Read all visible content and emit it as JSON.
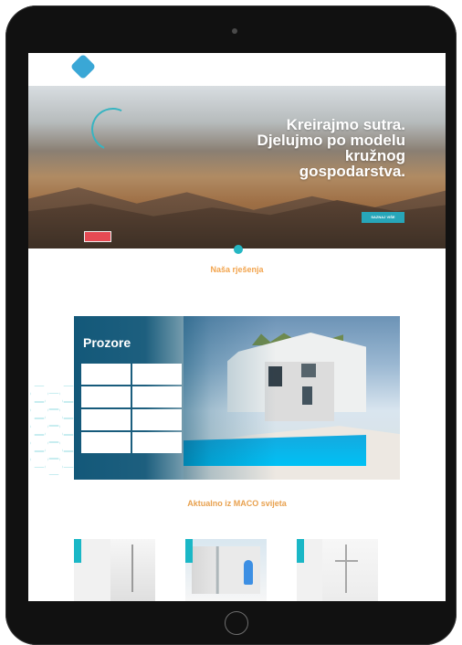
{
  "hero": {
    "title": "Kreirajmo sutra.\nDjelujmo po modelu\nkružnog\ngospodarstva.",
    "cta": "SAZNAJ VIŠE"
  },
  "solutions": {
    "title": "Naša rješenja"
  },
  "product_card": {
    "title": "Prozore"
  },
  "news": {
    "title": "Aktualno iz MACO svijeta"
  },
  "colors": {
    "accent": "#25b7c3",
    "orange": "#f2a44d",
    "blue_overlay": "#004b6f"
  }
}
